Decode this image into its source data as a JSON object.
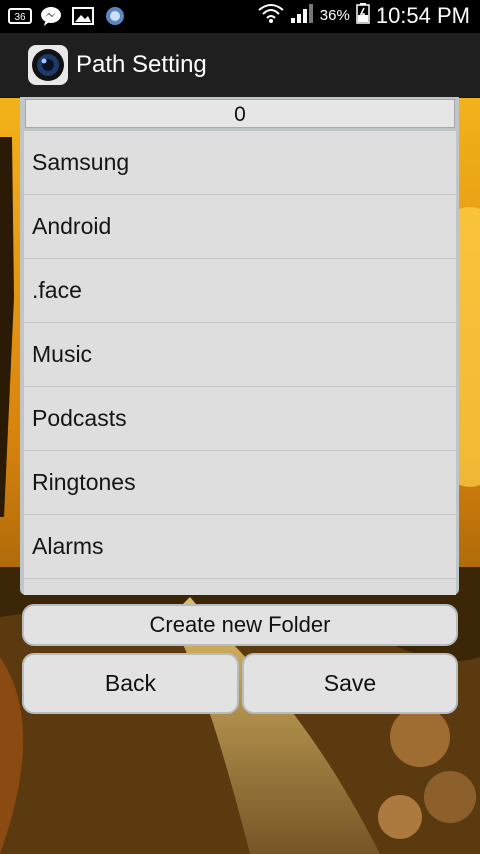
{
  "status_bar": {
    "icons": [
      "notification-36-icon",
      "messenger-icon",
      "gallery-icon",
      "app-update-icon"
    ],
    "battery_percent": "36%",
    "time": "10:54 PM"
  },
  "action_bar": {
    "title": "Path Setting",
    "icon": "camera-lens-icon"
  },
  "path": {
    "current": "0"
  },
  "folders": [
    "Samsung",
    "Android",
    ".face",
    "Music",
    "Podcasts",
    "Ringtones",
    "Alarms"
  ],
  "buttons": {
    "create_folder": "Create new Folder",
    "back": "Back",
    "save": "Save"
  },
  "notification_badge": "36"
}
